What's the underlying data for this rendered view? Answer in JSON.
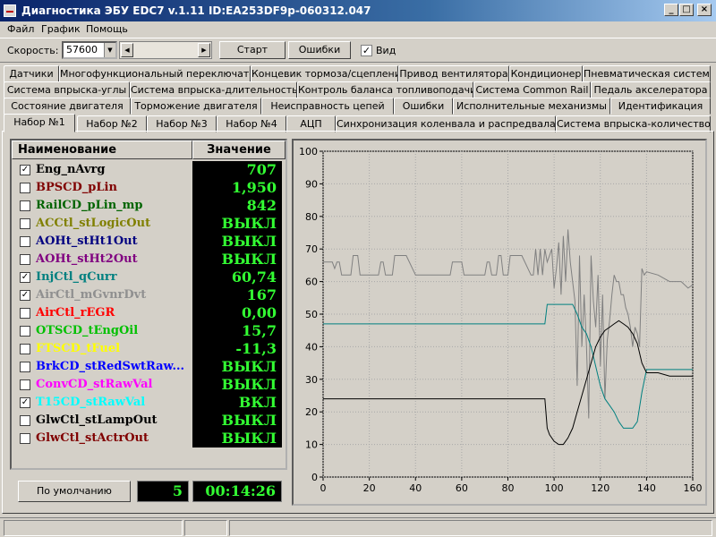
{
  "title": "Диагностика ЭБУ EDC7 v.1.11 ID:EA253DF9p-060312.047",
  "menu": [
    {
      "label": "Файл"
    },
    {
      "label": "График"
    },
    {
      "label": "Помощь"
    }
  ],
  "toolbar": {
    "speed_label": "Скорость:",
    "speed_value": "57600",
    "start_label": "Старт",
    "errors_label": "Ошибки",
    "view_label": "Вид",
    "view_checked": true
  },
  "tabs": {
    "row1": [
      "Датчики",
      "Многофункциональный переключатель",
      "Концевик тормоза/сцепления",
      "Привод вентилятора",
      "Кондиционер",
      "Пневматическая система"
    ],
    "row2": [
      "Система впрыска-углы",
      "Система впрыска-длительность",
      "Контроль баланса топливоподачи",
      "Система Common Rail",
      "Педаль акселератора"
    ],
    "row3": [
      "Состояние двигателя",
      "Торможение двигателя",
      "Неисправность цепей",
      "Ошибки",
      "Исполнительные механизмы",
      "Идентификация"
    ],
    "row4": [
      "Набор №1",
      "Набор №2",
      "Набор №3",
      "Набор №4",
      "АЦП",
      "Синхронизация коленвала и распредвала",
      "Система впрыска-количество"
    ],
    "active": "Набор №1"
  },
  "table": {
    "col_name": "Наименование",
    "col_value": "Значение",
    "rows": [
      {
        "name": "Eng_nAvrg",
        "value": "707",
        "checked": true,
        "color": "#000000"
      },
      {
        "name": "BPSCD_pLin",
        "value": "1,950",
        "checked": false,
        "color": "#800000"
      },
      {
        "name": "RailCD_pLin_mp",
        "value": "842",
        "checked": false,
        "color": "#006400"
      },
      {
        "name": "ACCtl_stLogicOut",
        "value": "ВЫКЛ",
        "checked": false,
        "color": "#808000"
      },
      {
        "name": "AOHt_stHt1Out",
        "value": "ВЫКЛ",
        "checked": false,
        "color": "#000080"
      },
      {
        "name": "AOHt_stHt2Out",
        "value": "ВЫКЛ",
        "checked": false,
        "color": "#800080"
      },
      {
        "name": "InjCtl_qCurr",
        "value": "60,74",
        "checked": true,
        "color": "#008080"
      },
      {
        "name": "AirCtl_mGvnrDvt",
        "value": "167",
        "checked": true,
        "color": "#909090"
      },
      {
        "name": "AirCtl_rEGR",
        "value": "0,00",
        "checked": false,
        "color": "#ff0000"
      },
      {
        "name": "OTSCD_tEngOil",
        "value": "15,7",
        "checked": false,
        "color": "#00c000"
      },
      {
        "name": "FTSCD_tFuel",
        "value": "-11,3",
        "checked": false,
        "color": "#ffff00"
      },
      {
        "name": "BrkCD_stRedSwtRaw...",
        "value": "ВЫКЛ",
        "checked": false,
        "color": "#0000ff"
      },
      {
        "name": "ConvCD_stRawVal",
        "value": "ВЫКЛ",
        "checked": false,
        "color": "#ff00ff"
      },
      {
        "name": "T15CD_stRawVal",
        "value": "ВКЛ",
        "checked": true,
        "color": "#00ffff"
      },
      {
        "name": "GlwCtl_stLampOut",
        "value": "ВЫКЛ",
        "checked": false,
        "color": "#000000"
      },
      {
        "name": "GlwCtl_stActrOut",
        "value": "ВЫКЛ",
        "checked": false,
        "color": "#800000"
      }
    ]
  },
  "bottom": {
    "default_button": "По умолчанию",
    "count": "5",
    "time": "00:14:26"
  },
  "chart_data": {
    "type": "line",
    "xlim": [
      0,
      160
    ],
    "ylim": [
      0,
      100
    ],
    "xticks": [
      0,
      20,
      40,
      60,
      80,
      100,
      120,
      140,
      160
    ],
    "yticks": [
      0,
      10,
      20,
      30,
      40,
      50,
      60,
      70,
      80,
      90,
      100
    ],
    "grid": true,
    "series": [
      {
        "color": "#808080",
        "x": [
          0,
          4,
          5,
          6,
          7,
          8,
          12,
          13,
          15,
          16,
          20,
          24,
          25,
          26,
          27,
          28,
          30,
          31,
          36,
          40,
          45,
          50,
          55,
          56,
          60,
          61,
          66,
          70,
          71,
          72,
          73,
          74,
          75,
          76,
          77,
          78,
          80,
          81,
          86,
          90,
          91,
          92,
          93,
          94,
          95,
          96,
          97,
          98,
          99,
          100,
          101,
          102,
          103,
          104,
          105,
          106,
          107,
          108,
          109,
          110,
          111,
          112,
          113,
          114,
          115,
          116,
          117,
          118,
          119,
          120,
          121,
          122,
          123,
          124,
          125,
          126,
          127,
          128,
          129,
          130,
          131,
          132,
          133,
          134,
          135,
          136,
          137,
          138,
          139,
          140,
          145,
          150,
          155,
          158,
          160
        ],
        "y": [
          66,
          66,
          64,
          66,
          66,
          62,
          62,
          68,
          68,
          62,
          62,
          62,
          66,
          66,
          62,
          62,
          62,
          68,
          68,
          62,
          62,
          62,
          62,
          66,
          66,
          62,
          62,
          62,
          66,
          66,
          62,
          62,
          62,
          68,
          68,
          62,
          62,
          68,
          68,
          62,
          62,
          70,
          62,
          70,
          62,
          70,
          66,
          68,
          70,
          58,
          64,
          72,
          56,
          74,
          60,
          76,
          66,
          60,
          54,
          28,
          68,
          40,
          56,
          40,
          18,
          68,
          54,
          46,
          62,
          34,
          56,
          24,
          42,
          48,
          56,
          62,
          60,
          60,
          56,
          56,
          52,
          50,
          46,
          40,
          46,
          44,
          40,
          64,
          62,
          63,
          62,
          60,
          60,
          58,
          59
        ]
      },
      {
        "color": "#008080",
        "x": [
          0,
          96,
          97,
          108,
          110,
          112,
          114,
          116,
          118,
          120,
          122,
          124,
          126,
          128,
          130,
          132,
          134,
          136,
          138,
          140,
          145,
          150,
          155,
          160
        ],
        "y": [
          47,
          47,
          53,
          53,
          50,
          46,
          44,
          40,
          34,
          28,
          24,
          22,
          20,
          17,
          15,
          15,
          15,
          17,
          26,
          33,
          33,
          33,
          33,
          33
        ]
      },
      {
        "color": "#000000",
        "x": [
          0,
          96,
          97,
          98,
          100,
          102,
          104,
          106,
          108,
          110,
          112,
          114,
          116,
          118,
          120,
          122,
          124,
          126,
          128,
          130,
          132,
          134,
          136,
          138,
          140,
          145,
          150,
          155,
          160
        ],
        "y": [
          24,
          24,
          15,
          13,
          11,
          10,
          10,
          12,
          15,
          20,
          25,
          30,
          35,
          40,
          43,
          45,
          46,
          47,
          48,
          47,
          46,
          44,
          41,
          35,
          32,
          32,
          31,
          31,
          31
        ]
      }
    ]
  }
}
